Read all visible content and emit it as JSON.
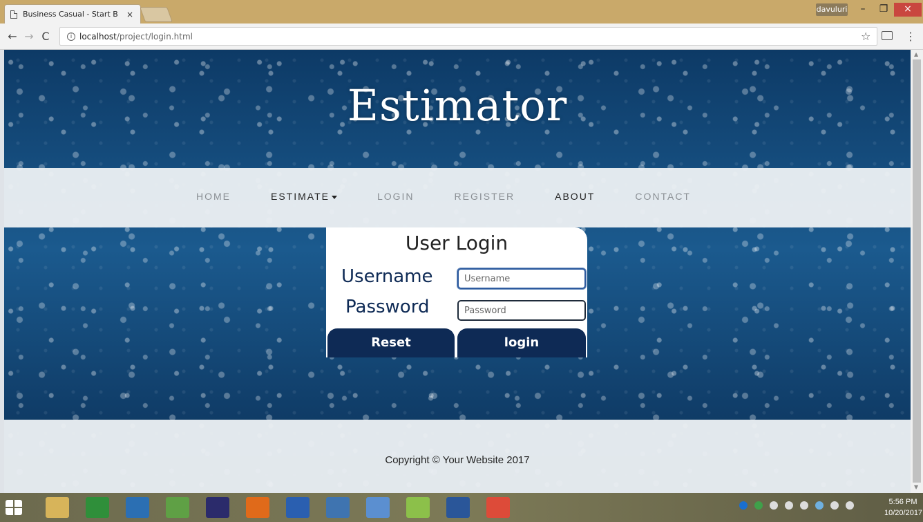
{
  "browser": {
    "tab_title": "Business Casual - Start B",
    "tab_close": "×",
    "user": "davuluri",
    "window_min": "–",
    "window_max": "❐",
    "window_close": "×",
    "back": "←",
    "forward": "→",
    "reload": "C",
    "info": "i",
    "url_host": "localhost",
    "url_path": "/project/login.html",
    "star": "☆",
    "menu": "⋮"
  },
  "site": {
    "title": "Estimator"
  },
  "nav": {
    "items": [
      {
        "label": "HOME",
        "style": "light"
      },
      {
        "label": "ESTIMATE",
        "style": "dark",
        "dropdown": true
      },
      {
        "label": "LOGIN",
        "style": "light"
      },
      {
        "label": "REGISTER",
        "style": "light"
      },
      {
        "label": "ABOUT",
        "style": "dark"
      },
      {
        "label": "CONTACT",
        "style": "light"
      }
    ]
  },
  "login": {
    "title": "User Login",
    "username_label": "Username",
    "username_placeholder": "Username",
    "password_label": "Password",
    "password_placeholder": "Password",
    "reset_label": "Reset",
    "login_label": "login"
  },
  "footer": {
    "copyright": "Copyright © Your Website 2017"
  },
  "taskbar": {
    "icons": [
      {
        "name": "file-explorer-icon",
        "color": "#d7b45a"
      },
      {
        "name": "store-icon",
        "color": "#2f8f3a"
      },
      {
        "name": "photos-icon",
        "color": "#2b6fb3"
      },
      {
        "name": "android-studio-icon",
        "color": "#5fa045"
      },
      {
        "name": "eclipse-icon",
        "color": "#2b2b6b"
      },
      {
        "name": "firefox-icon",
        "color": "#e06a1a"
      },
      {
        "name": "r-icon",
        "color": "#2a5fb0"
      },
      {
        "name": "python-icon",
        "color": "#3f74b0"
      },
      {
        "name": "notepad-icon",
        "color": "#5b8fd0"
      },
      {
        "name": "notepadpp-icon",
        "color": "#8cc04a"
      },
      {
        "name": "word-icon",
        "color": "#2a5699"
      },
      {
        "name": "chrome-icon",
        "color": "#dd4b39"
      }
    ],
    "time": "5:56 PM",
    "date": "10/20/2017"
  }
}
